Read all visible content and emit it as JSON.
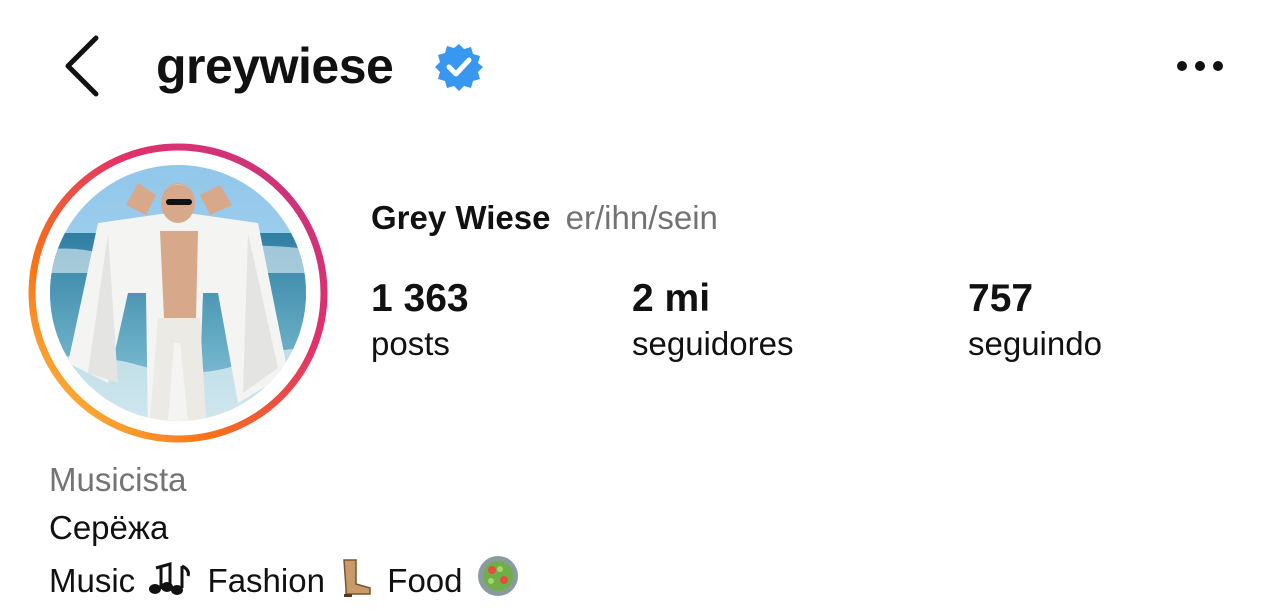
{
  "header": {
    "username": "greywiese",
    "back_icon": "chevron-left-icon",
    "verified_icon": "verified-badge-icon",
    "more_icon": "more-horizontal-icon",
    "verified_color": "#3897F0"
  },
  "profile": {
    "full_name": "Grey Wiese",
    "pronouns": "er/ihn/sein",
    "story_ring_colors": [
      "#FCAF45",
      "#F77737",
      "#E1306C",
      "#C13584"
    ],
    "avatar_icon": "profile-photo"
  },
  "stats": {
    "posts": {
      "value": "1 363",
      "label": "posts"
    },
    "followers": {
      "value": "2 mi",
      "label": "seguidores"
    },
    "following": {
      "value": "757",
      "label": "seguindo"
    }
  },
  "bio": {
    "category": "Musicista",
    "line1": "Серёжа",
    "line2_part1": "Music",
    "line2_emoji1": "music-notes-icon",
    "line2_part2": "Fashion",
    "line2_emoji2": "cowboy-boot-icon",
    "line2_part3": "Food",
    "line2_emoji3": "salad-icon"
  }
}
